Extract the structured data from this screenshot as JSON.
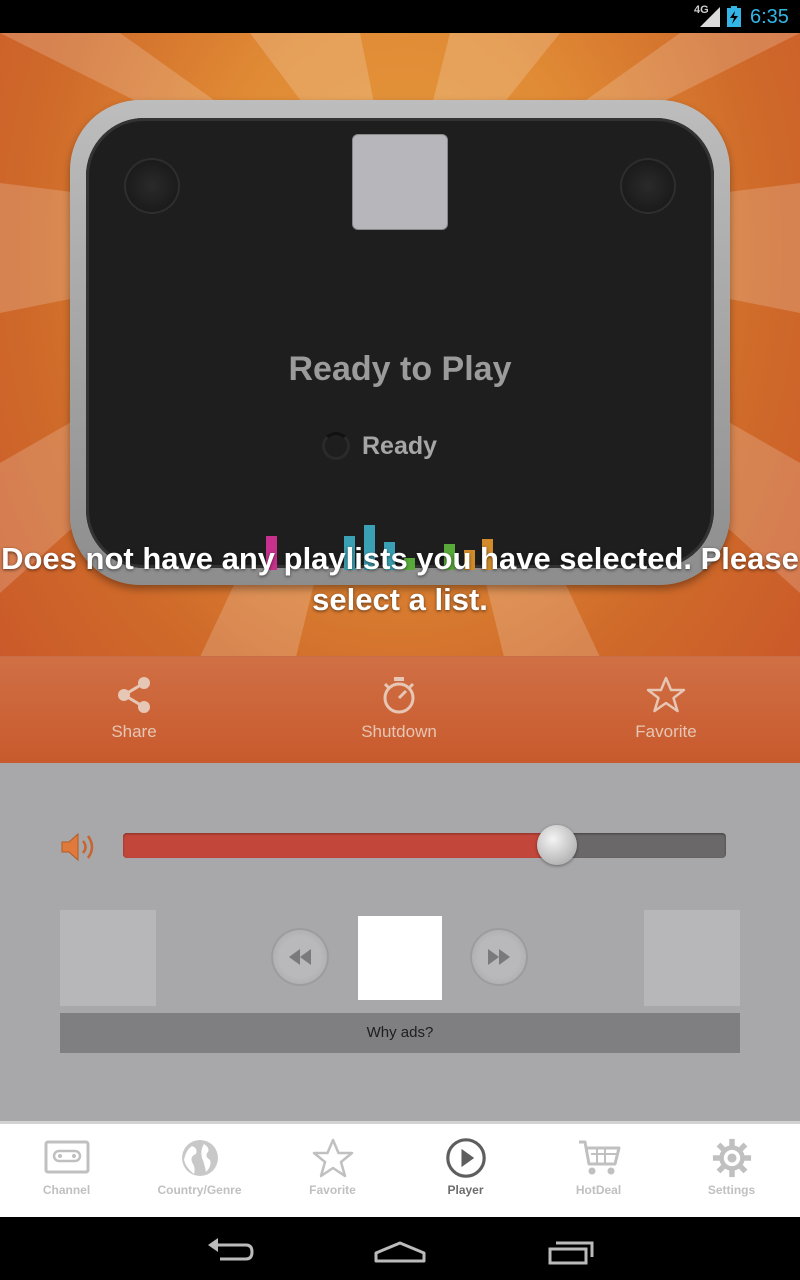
{
  "status_bar": {
    "network": "4G",
    "time": "6:35"
  },
  "player": {
    "title": "Ready to Play",
    "status": "Ready",
    "message": "Does not have any playlists you have selected. Please select a list."
  },
  "actions": [
    {
      "label": "Share",
      "icon": "share-icon"
    },
    {
      "label": "Shutdown",
      "icon": "timer-icon"
    },
    {
      "label": "Favorite",
      "icon": "star-icon"
    }
  ],
  "volume": {
    "level": 0.72
  },
  "ads": {
    "why_label": "Why ads?"
  },
  "tabs": [
    {
      "label": "Channel",
      "icon": "cassette-icon",
      "active": false
    },
    {
      "label": "Country/Genre",
      "icon": "globe-icon",
      "active": false
    },
    {
      "label": "Favorite",
      "icon": "star-icon",
      "active": false
    },
    {
      "label": "Player",
      "icon": "play-icon",
      "active": true
    },
    {
      "label": "HotDeal",
      "icon": "cart-icon",
      "active": false
    },
    {
      "label": "Settings",
      "icon": "gear-icon",
      "active": false
    }
  ],
  "colors": {
    "accent": "#33b5e5",
    "stage": "#e08a35",
    "volume_fill": "#c2463a"
  }
}
